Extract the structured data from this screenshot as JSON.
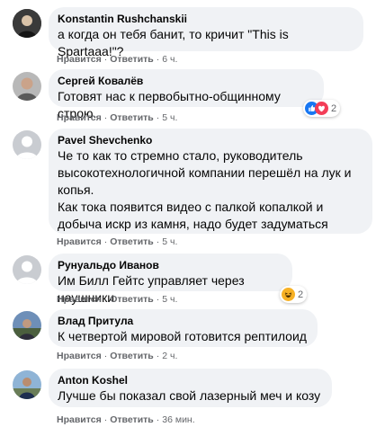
{
  "comments": [
    {
      "author": "Konstantin Rushchanskii",
      "text": "а когда он тебя банит, то кричит \"This is Spartaaa!\"?",
      "like_label": "Нравится",
      "reply_label": "Ответить",
      "time": "6 ч."
    },
    {
      "author": "Сергей Ковалёв",
      "text": "Готовят нас к первобытно-общинному строю.",
      "like_label": "Нравится",
      "reply_label": "Ответить",
      "time": "5 ч.",
      "reaction": {
        "icons": [
          "like",
          "love"
        ],
        "count": "2"
      }
    },
    {
      "author": "Pavel Shevchenko",
      "text": "Че то как то стремно стало, руководитель высокотехнологичной компании перешёл на лук и копья.\nКак тока появится видео с палкой копалкой и добыча искр из камня, надо будет задуматься",
      "like_label": "Нравится",
      "reply_label": "Ответить",
      "time": "5 ч."
    },
    {
      "author": "Рунуальдо Иванов",
      "text": "Им Билл Гейтс управляет через наушники",
      "like_label": "Нравится",
      "reply_label": "Ответить",
      "time": "5 ч.",
      "reaction": {
        "icons": [
          "haha"
        ],
        "count": "2"
      }
    },
    {
      "author": "Влад Притула",
      "text": "К четвертой мировой готовится рептилоид",
      "like_label": "Нравится",
      "reply_label": "Ответить",
      "time": "2 ч."
    },
    {
      "author": "Anton Koshel",
      "text": "Лучше бы показал свой лазерный меч и козу",
      "like_label": "Нравится",
      "reply_label": "Ответить",
      "time": "36 мин."
    }
  ],
  "colors": {
    "bubble": "#f0f2f5",
    "meta_text": "#65676b",
    "like_blue": "#1877f2",
    "love_red": "#f33e58",
    "haha_yellow": "#f7b125"
  }
}
